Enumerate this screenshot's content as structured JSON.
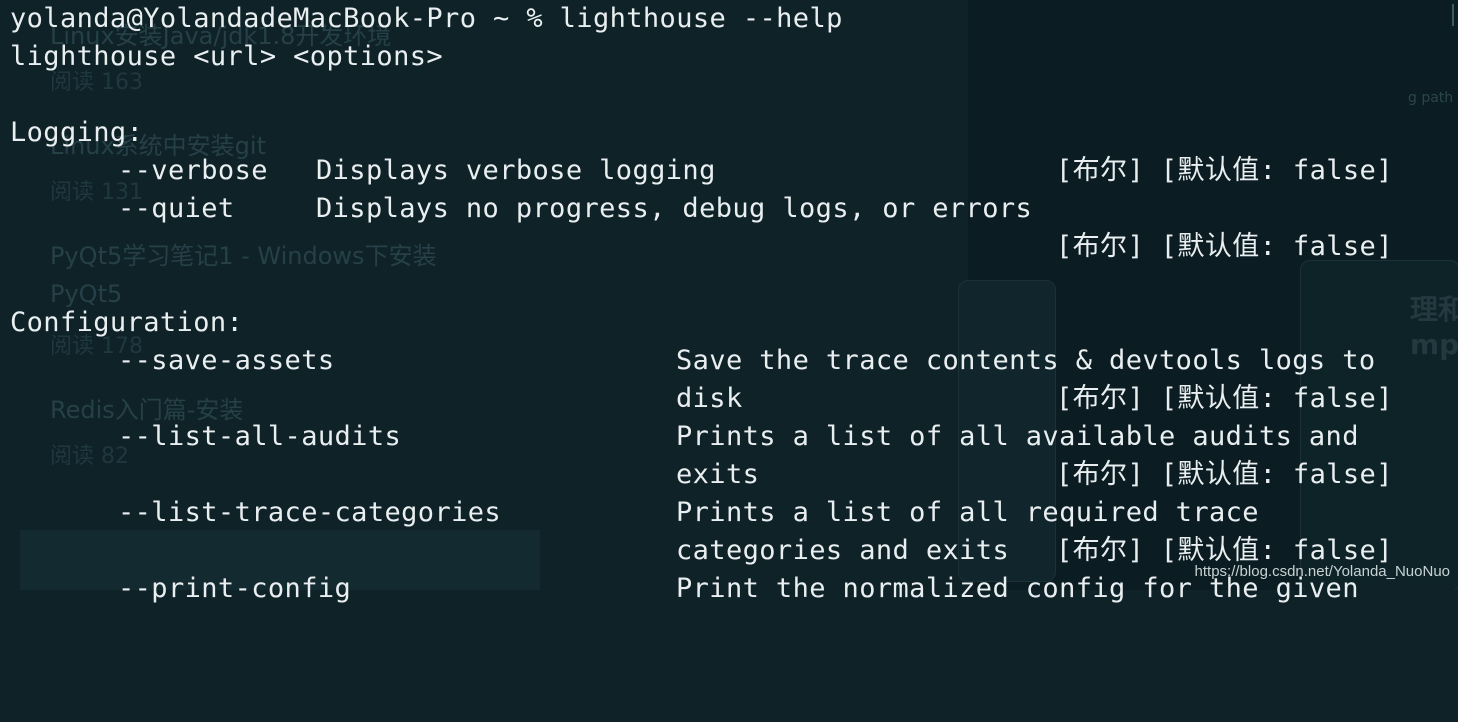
{
  "background_page": {
    "items": [
      {
        "title": "Linux安装Java/jdk1.8开发环境",
        "reads": "阅读 163"
      },
      {
        "title": "Linux系统中安装git",
        "reads": "阅读 131"
      },
      {
        "title": "PyQt5学习笔记1 - Windows下安装",
        "title2": "PyQt5",
        "reads": "阅读 178"
      },
      {
        "title": "Redis入门篇-安装",
        "reads": "阅读 82"
      }
    ],
    "side_text_1": "g path",
    "side_text_2": "理和",
    "side_text_3": "mp"
  },
  "terminal": {
    "prompt": "yolanda@YolandadeMacBook-Pro ~ % lighthouse --help",
    "usage": "lighthouse <url> <options>",
    "sections": [
      {
        "heading": "Logging:",
        "options": [
          {
            "flag": "--verbose",
            "description": "Displays verbose logging",
            "type_tag": "[布尔] [默认值: false]"
          },
          {
            "flag": "--quiet",
            "description": "Displays no progress, debug logs, or errors",
            "type_tag": "[布尔] [默认值: false]"
          }
        ]
      },
      {
        "heading": "Configuration:",
        "options": [
          {
            "flag": "--save-assets",
            "description_line1": "Save the trace contents & devtools logs to",
            "description_line2": "disk",
            "type_tag": "[布尔] [默认值: false]"
          },
          {
            "flag": "--list-all-audits",
            "description_line1": "Prints a list of all available audits and",
            "description_line2": "exits",
            "type_tag": "[布尔] [默认值: false]"
          },
          {
            "flag": "--list-trace-categories",
            "description_line1": "Prints a list of all required trace",
            "description_line2": "categories and exits",
            "type_tag": "[布尔] [默认值: false]"
          },
          {
            "flag": "--print-config",
            "description_line1": "Print the normalized config for the given"
          }
        ]
      }
    ]
  },
  "watermark": "https://blog.csdn.net/Yolanda_NuoNuo",
  "colors": {
    "terminal_bg": "#0e2228",
    "terminal_fg": "#e9eef0"
  }
}
